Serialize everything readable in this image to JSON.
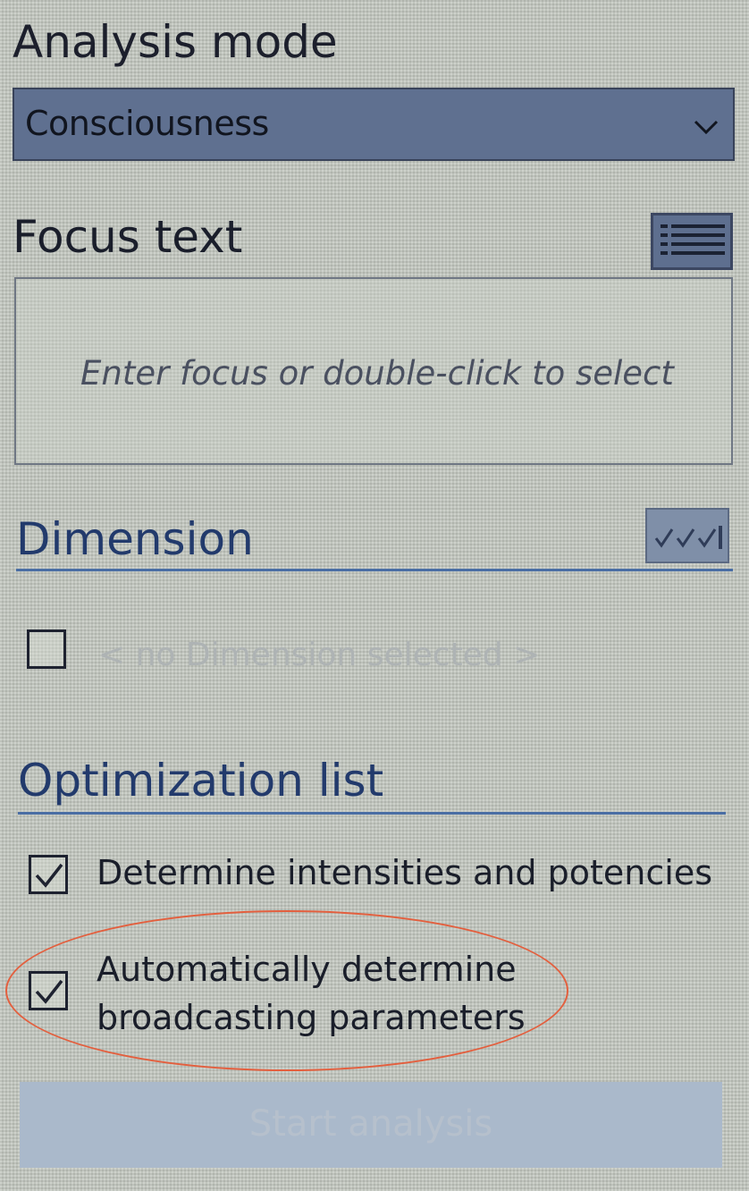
{
  "analysis_mode": {
    "heading": "Analysis mode",
    "selected_value": "Consciousness"
  },
  "focus_text": {
    "heading": "Focus text",
    "placeholder": "Enter focus or double-click to select"
  },
  "dimension": {
    "heading": "Dimension",
    "empty_label": "< no Dimension selected >",
    "checked": false
  },
  "optimization_list": {
    "heading": "Optimization list",
    "items": [
      {
        "label_lines": [
          "Determine intensities and potencies"
        ],
        "checked": true
      },
      {
        "label_lines": [
          "Automatically determine",
          "broadcasting parameters"
        ],
        "checked": true,
        "highlighted": true
      }
    ]
  },
  "start_button": {
    "label": "Start analysis",
    "enabled": false
  },
  "colors": {
    "accent_blue": "#223a6c",
    "select_bg": "#5f7090",
    "highlight_red": "#e35f3e",
    "disabled_button": "#aab9cb"
  }
}
